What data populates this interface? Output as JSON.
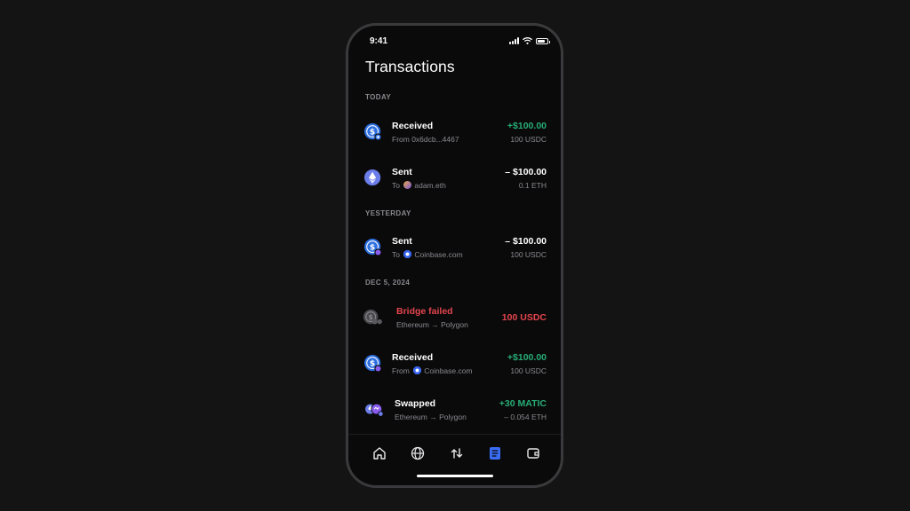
{
  "status_bar": {
    "time": "9:41"
  },
  "header": {
    "title": "Transactions"
  },
  "sections": [
    {
      "label": "TODAY"
    },
    {
      "label": "YESTERDAY"
    },
    {
      "label": "DEC 5, 2024"
    }
  ],
  "transactions": [
    {
      "title": "Received",
      "subtitle": "From 0x6dcb...4467",
      "amount": "+$100.00",
      "detail": "100 USDC",
      "icon": "usdc-icon"
    },
    {
      "title": "Sent",
      "subtitle_prefix": "To",
      "subtitle_name": "adam.eth",
      "amount": "– $100.00",
      "detail": "0.1 ETH",
      "icon": "eth-icon"
    },
    {
      "title": "Sent",
      "subtitle_prefix": "To",
      "subtitle_name": "Coinbase.com",
      "amount": "– $100.00",
      "detail": "100 USDC",
      "icon": "usdc-icon"
    },
    {
      "title": "Bridge failed",
      "subtitle": "Ethereum → Polygon",
      "amount": "100 USDC",
      "icon": "bridge-icon"
    },
    {
      "title": "Received",
      "subtitle_prefix": "From",
      "subtitle_name": "Coinbase.com",
      "amount": "+$100.00",
      "detail": "100 USDC",
      "icon": "usdc-icon"
    },
    {
      "title": "Swapped",
      "subtitle": "Ethereum → Polygon",
      "amount": "+30 MATIC",
      "detail": "– 0.054 ETH",
      "icon": "swap-icon"
    }
  ],
  "tab_bar": {
    "tabs": [
      "home-icon",
      "globe-icon",
      "transfer-icon",
      "transactions-icon",
      "wallet-icon"
    ],
    "active": "transactions-icon"
  },
  "colors": {
    "positive": "#27ad75",
    "negative": "#e5454d",
    "accent": "#3a6cf4",
    "background": "#0a0a0b"
  }
}
